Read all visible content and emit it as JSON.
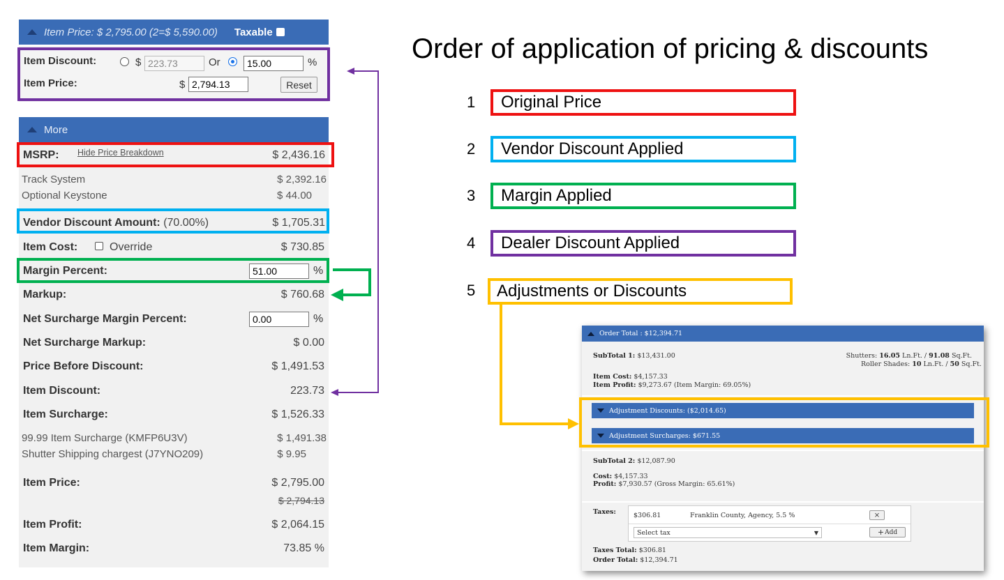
{
  "left_panel": {
    "header": {
      "item_price_text": "Item Price: $ 2,795.00 (2=$ 5,590.00)",
      "taxable_label": "Taxable"
    },
    "discount": {
      "item_discount_label": "Item Discount:",
      "dollar_sign": "$",
      "discount_amount_value": "223.73",
      "or_label": "Or",
      "discount_percent_value": "15.00",
      "percent_sign": "%",
      "item_price_label": "Item Price:",
      "item_price_value": "2,794.13",
      "reset_label": "Reset"
    },
    "more_bar": {
      "label": "More"
    },
    "msrp": {
      "label": "MSRP:",
      "link": "Hide Price Breakdown",
      "value": "$ 2,436.16"
    },
    "breakdown": [
      {
        "label": "Track System",
        "value": "$ 2,392.16"
      },
      {
        "label": "Optional Keystone",
        "value": "$ 44.00"
      }
    ],
    "vendor_discount": {
      "label": "Vendor Discount Amount:",
      "pct": "(70.00%)",
      "value": "$ 1,705.31"
    },
    "item_cost": {
      "label": "Item Cost:",
      "override_label": "Override",
      "value": "$ 730.85"
    },
    "margin_percent": {
      "label": "Margin Percent:",
      "value": "51.00",
      "unit": "%"
    },
    "markup": {
      "label": "Markup:",
      "value": "$ 760.68"
    },
    "net_surcharge_margin": {
      "label": "Net Surcharge Margin Percent:",
      "value": "0.00",
      "unit": "%"
    },
    "net_surcharge_markup": {
      "label": "Net Surcharge Markup:",
      "value": "$ 0.00"
    },
    "price_before_discount": {
      "label": "Price Before Discount:",
      "value": "$ 1,491.53"
    },
    "item_discount_row": {
      "label": "Item Discount:",
      "value": "223.73"
    },
    "item_surcharge": {
      "label": "Item Surcharge:",
      "value": "$ 1,526.33"
    },
    "surcharges": [
      {
        "label": "99.99 Item Surcharge (KMFP6U3V)",
        "value": "$ 1,491.38"
      },
      {
        "label": "Shutter Shipping chargest (J7YNO209)",
        "value": "$ 9.95"
      }
    ],
    "item_price_row": {
      "label": "Item Price:",
      "value": "$ 2,795.00",
      "struck": "$ 2,794.13"
    },
    "item_profit": {
      "label": "Item Profit:",
      "value": "$ 2,064.15"
    },
    "item_margin": {
      "label": "Item Margin:",
      "value": "73.85 %"
    }
  },
  "legend": {
    "title": "Order of application of pricing & discounts",
    "items": [
      {
        "num": "1",
        "label": "Original Price",
        "color": "#ee1111"
      },
      {
        "num": "2",
        "label": "Vendor Discount Applied",
        "color": "#00b0f0"
      },
      {
        "num": "3",
        "label": "Margin Applied",
        "color": "#00b050"
      },
      {
        "num": "4",
        "label": "Dealer Discount Applied",
        "color": "#7030a0"
      },
      {
        "num": "5",
        "label": "Adjustments or Discounts",
        "color": "#ffc000"
      }
    ]
  },
  "order_panel": {
    "header": "Order Total : $12,394.71",
    "subtotal1": {
      "label": "SubTotal 1:",
      "value": "$13,431.00"
    },
    "shutters": {
      "label": "Shutters:",
      "lnft": "16.05",
      "lnft_unit": "Ln.Ft. /",
      "sqft": "91.08",
      "sqft_unit": "Sq.Ft."
    },
    "roller": {
      "label": "Roller Shades:",
      "lnft": "10",
      "lnft_unit": "Ln.Ft. /",
      "sqft": "50",
      "sqft_unit": "Sq.Ft."
    },
    "item_cost": {
      "label": "Item Cost:",
      "value": "$4,157.33"
    },
    "item_profit": {
      "label": "Item Profit:",
      "value": "$9,273.67 (Item Margin: 69.05%)"
    },
    "adj_discounts": "Adjustment Discounts: ($2,014.65)",
    "adj_surcharges": "Adjustment Surcharges: $671.55",
    "subtotal2": {
      "label": "SubTotal 2:",
      "value": "$12,087.90"
    },
    "cost": {
      "label": "Cost:",
      "value": "$4,157.33"
    },
    "profit": {
      "label": "Profit:",
      "value": "$7,930.57 (Gross Margin: 65.61%)"
    },
    "taxes_label": "Taxes:",
    "tax_row": {
      "amount": "$306.81",
      "name": "Franklin County, Agency, 5.5 %",
      "remove": "×"
    },
    "select_tax": "Select tax",
    "add_label": "Add",
    "taxes_total": {
      "label": "Taxes Total:",
      "value": "$306.81"
    },
    "order_total": {
      "label": "Order Total:",
      "value": "$12,394.71"
    }
  }
}
